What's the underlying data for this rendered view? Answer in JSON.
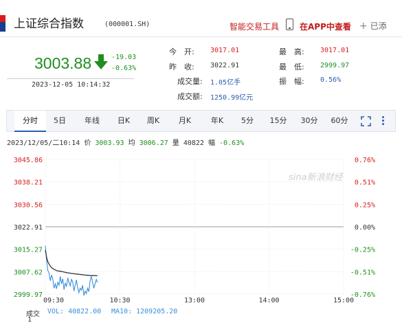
{
  "header": {
    "title": "上证综合指数",
    "code": "(000001.SH)",
    "tool_link": "智能交易工具",
    "app_link": "在APP中查看",
    "add_label": "已添"
  },
  "quote": {
    "price": "3003.88",
    "change": "-19.03",
    "change_pct": "-0.63%",
    "datetime": "2023-12-05 10:14:32",
    "stats": {
      "open_label": "今　开:",
      "open": "3017.01",
      "prev_label": "昨　收:",
      "prev": "3022.91",
      "volume_label": "成交量:",
      "volume": "1.05亿手",
      "amount_label": "成交额:",
      "amount": "1250.99亿元",
      "high_label": "最　高:",
      "high": "3017.01",
      "low_label": "最　低:",
      "low": "2999.97",
      "amp_label": "振　幅:",
      "amp": "0.56%"
    }
  },
  "tabs": [
    "分时",
    "5日",
    "年线",
    "日K",
    "周K",
    "月K",
    "年K",
    "5分",
    "15分",
    "30分",
    "60分"
  ],
  "active_tab": "分时",
  "info": {
    "date": "2023/12/05/二10:14",
    "price_label": "价",
    "price": "3003.93",
    "avg_label": "均",
    "avg": "3006.27",
    "vol_label": "量",
    "vol": "40822",
    "chg_label": "幅",
    "chg": "-0.63%"
  },
  "watermark": "sina新浪财经",
  "footer": {
    "label": "成交",
    "vol": "VOL: 40822.00",
    "ma10": "MA10: 1209205.20",
    "scale": "1"
  },
  "colors": {
    "up": "#d81e1e",
    "down": "#1f8f1f",
    "neutral": "#333333",
    "price_line": "#3a8fd8",
    "avg_line": "#333333"
  },
  "chart_data": {
    "type": "line",
    "left_ticks": [
      "3045.86",
      "3038.21",
      "3030.56",
      "3022.91",
      "3015.27",
      "3007.62",
      "2999.97"
    ],
    "right_ticks": [
      "0.76%",
      "0.51%",
      "0.25%",
      "0.00%",
      "-0.25%",
      "-0.51%",
      "-0.76%"
    ],
    "x_ticks": [
      "09:30",
      "10:30",
      "13:00",
      "14:00",
      "15:00"
    ],
    "ylim": [
      2999.97,
      3045.86
    ],
    "prev_close": 3022.91,
    "total_minutes": 240,
    "series": [
      {
        "values": [
          3016.5,
          3011.5,
          3008.0,
          3007.2,
          3004.5,
          3006.5,
          3005.0,
          3002.0,
          3003.5,
          3001.8,
          3004.0,
          3003.0,
          3006.0,
          3003.5,
          3005.2,
          3001.5,
          3003.8,
          3002.5,
          3005.5,
          3004.0,
          3002.8,
          3005.0,
          3004.2,
          3001.0,
          3003.0,
          3004.8,
          3002.2,
          3000.5,
          3002.0,
          3001.3,
          3003.0,
          2999.5,
          3001.0,
          3000.2,
          3002.0,
          3000.8,
          3004.5,
          3006.0,
          3004.0,
          3002.0,
          3003.5,
          3005.0,
          3003.93
        ]
      },
      {
        "values": [
          3015.0,
          3012.5,
          3011.0,
          3010.2,
          3009.5,
          3009.0,
          3008.7,
          3008.4,
          3008.2,
          3008.0,
          3007.9,
          3007.8,
          3007.8,
          3007.7,
          3007.6,
          3007.5,
          3007.4,
          3007.3,
          3007.2,
          3007.2,
          3007.1,
          3007.0,
          3007.0,
          3006.9,
          3006.9,
          3006.8,
          3006.8,
          3006.7,
          3006.7,
          3006.6,
          3006.6,
          3006.5,
          3006.5,
          3006.4,
          3006.4,
          3006.4,
          3006.3,
          3006.3,
          3006.3,
          3006.3,
          3006.3,
          3006.27,
          3006.27
        ]
      }
    ]
  }
}
